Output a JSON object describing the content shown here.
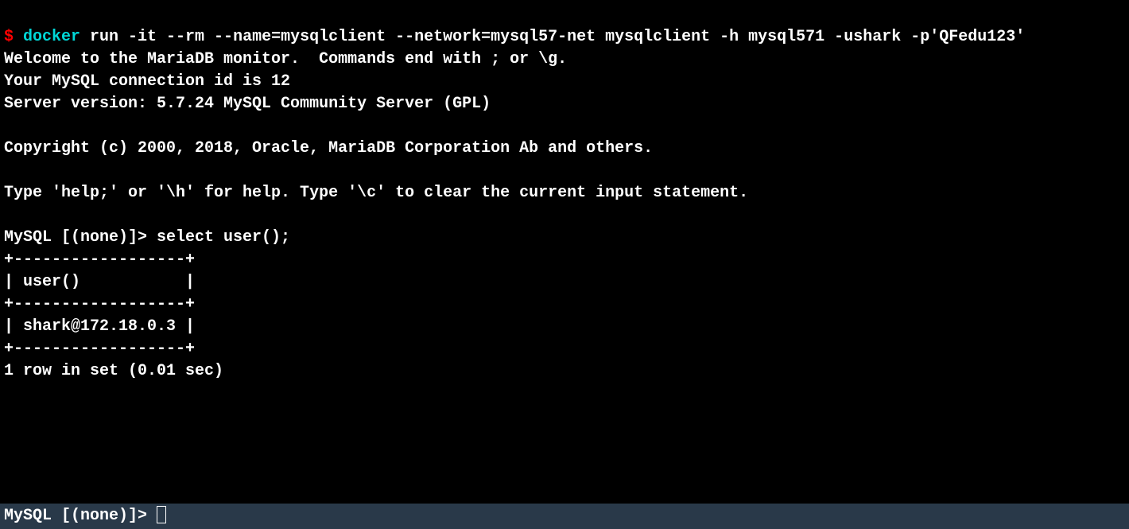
{
  "prompt": {
    "dollar": "$",
    "cmd_keyword": " docker",
    "cmd_args": " run -it --rm --name=mysqlclient --network=mysql57-net mysqlclient -h mysql571 -ushark -p'QFedu123'"
  },
  "output": {
    "welcome": "Welcome to the MariaDB monitor.  Commands end with ; or \\g.",
    "conn_id": "Your MySQL connection id is 12",
    "server_ver": "Server version: 5.7.24 MySQL Community Server (GPL)",
    "blank1": "",
    "copyright": "Copyright (c) 2000, 2018, Oracle, MariaDB Corporation Ab and others.",
    "blank2": "",
    "help": "Type 'help;' or '\\h' for help. Type '\\c' to clear the current input statement.",
    "blank3": ""
  },
  "query": {
    "prompt_query": "MySQL [(none)]> select user();",
    "border1": "+------------------+",
    "header": "| user()           |",
    "border2": "+------------------+",
    "row": "| shark@172.18.0.3 |",
    "border3": "+------------------+",
    "result": "1 row in set (0.01 sec)"
  },
  "bottom": {
    "mysql_prompt": "MySQL [(none)]> "
  }
}
